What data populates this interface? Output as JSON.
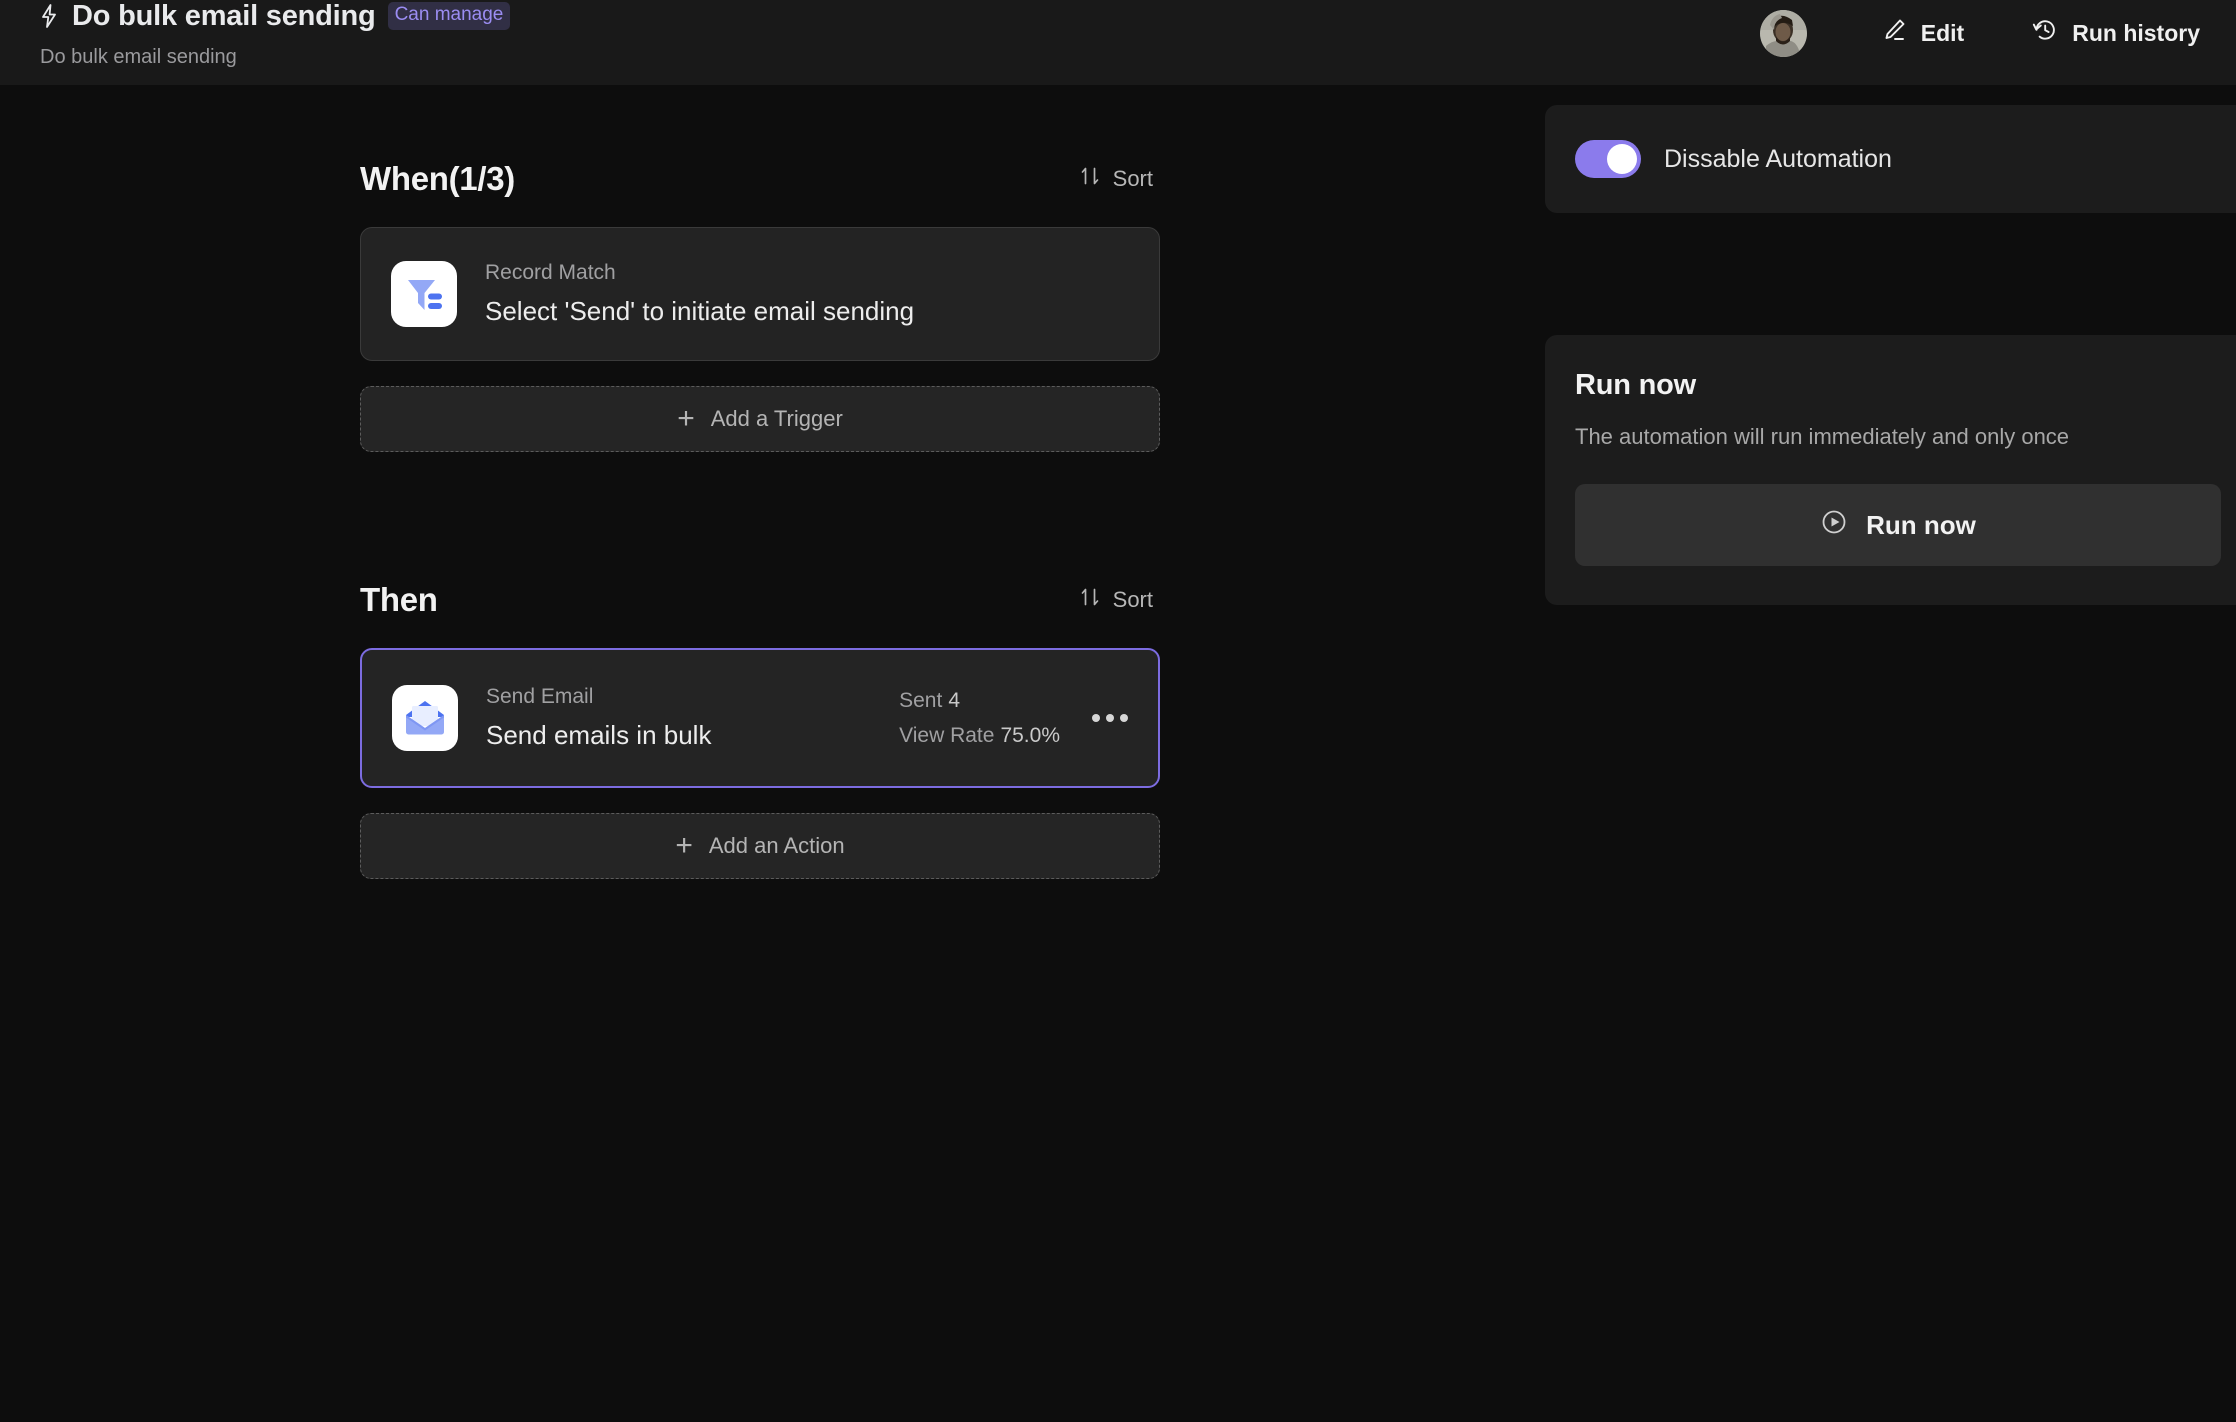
{
  "header": {
    "bolt_icon": "lightning-bolt-icon",
    "title": "Do bulk email sending",
    "badge": "Can manage",
    "subtitle": "Do bulk email sending",
    "avatar_alt": "user-avatar",
    "edit_label": "Edit",
    "edit_icon": "pencil-icon",
    "run_history_label": "Run history",
    "run_history_icon": "history-clock-icon"
  },
  "when_section": {
    "title": "When(1/3)",
    "sort_label": "Sort",
    "sort_icon": "sort-arrows-icon",
    "trigger": {
      "icon": "filter-funnel-icon",
      "kicker": "Record Match",
      "title": "Select 'Send' to initiate email sending"
    },
    "add_label": "Add a Trigger",
    "add_icon": "plus-icon"
  },
  "then_section": {
    "title": "Then",
    "sort_label": "Sort",
    "sort_icon": "sort-arrows-icon",
    "action": {
      "icon": "open-envelope-icon",
      "kicker": "Send Email",
      "title": "Send emails in bulk",
      "stat_sent_label": "Sent",
      "stat_sent_value": "4",
      "stat_viewrate_label": "View Rate",
      "stat_viewrate_value": "75.0%",
      "more_icon": "ellipsis-icon"
    },
    "add_label": "Add an Action",
    "add_icon": "plus-icon"
  },
  "right_panel": {
    "toggle_label": "Dissable Automation",
    "toggle_on": true,
    "run_now_title": "Run now",
    "run_now_desc": "The automation will run immediately and only once",
    "run_now_button": "Run now",
    "run_now_icon": "play-circle-icon"
  },
  "colors": {
    "accent_purple": "#8b7bec",
    "badge_text": "#9b8df2",
    "badge_bg": "#312f45",
    "card_border_selected": "#7c6ce0",
    "page_bg": "#0d0d0d",
    "header_bg": "#191919",
    "card_bg": "#232323",
    "icon_blue": "#8fa6f5",
    "icon_blue_dark": "#4a6ef0"
  }
}
